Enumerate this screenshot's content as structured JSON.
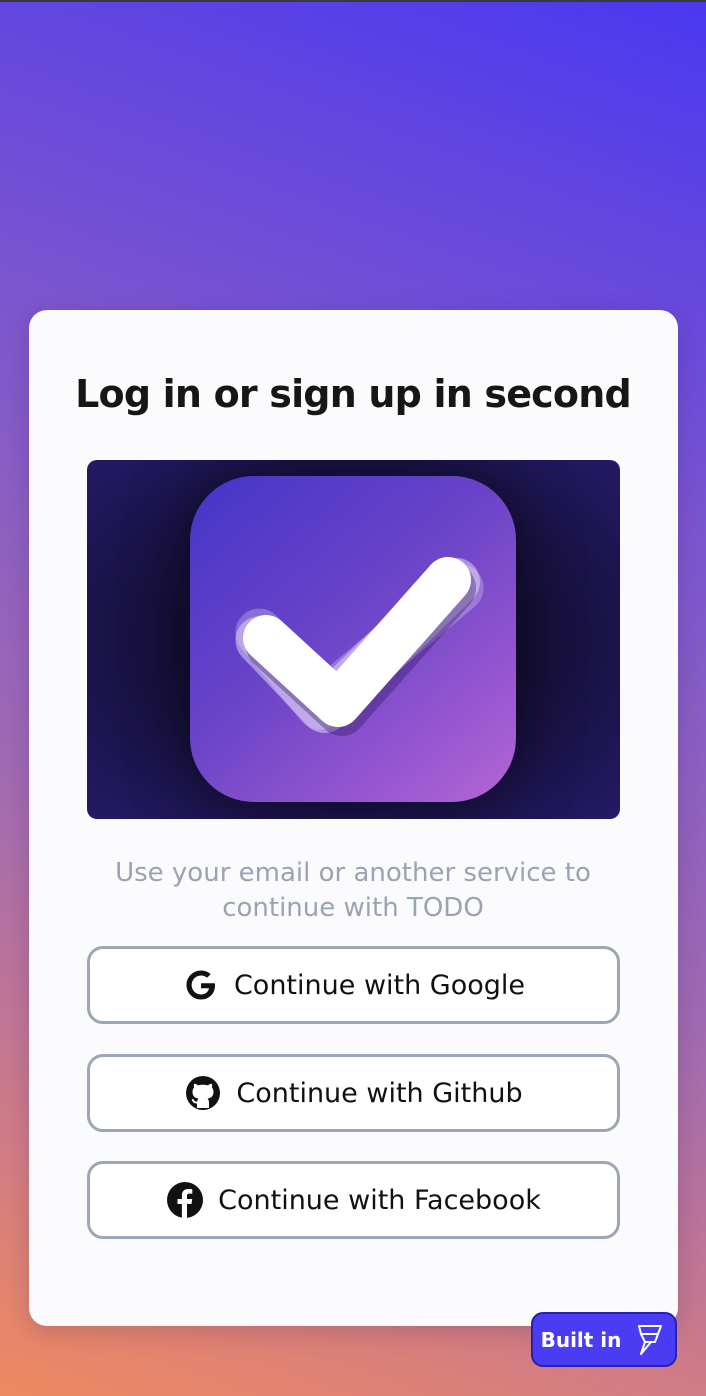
{
  "login": {
    "title": "Log in or sign up in second",
    "subtitle": "Use your email or another service to continue with TODO",
    "hero_icon": "checkmark-app-icon",
    "buttons": {
      "google": {
        "label": "Continue with Google",
        "icon": "google-icon"
      },
      "github": {
        "label": "Continue with Github",
        "icon": "github-icon"
      },
      "facebook": {
        "label": "Continue with Facebook",
        "icon": "facebook-icon"
      }
    }
  },
  "badge": {
    "label": "Built in",
    "icon": "framer-logo-icon"
  },
  "colors": {
    "card": "#fbfbfd",
    "button_border": "#9ba6b6",
    "subtitle": "#9aa3b3",
    "badge": "#4a3cf2"
  }
}
